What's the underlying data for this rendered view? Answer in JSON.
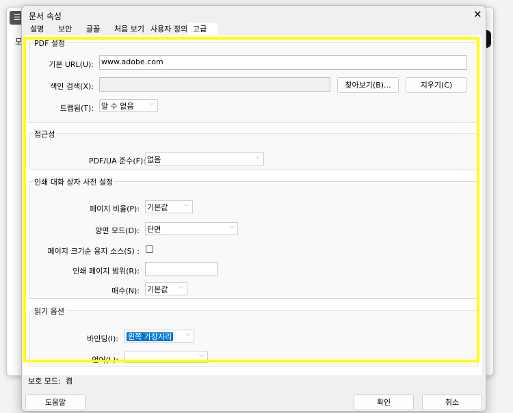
{
  "background": {
    "menu_icon": "hamburger-icon",
    "tab_text": "모"
  },
  "dialog": {
    "title": "문서 속성",
    "close_icon": "close-icon",
    "tabs": [
      "설명",
      "보안",
      "글꼴",
      "처음 보기",
      "사용자 정의",
      "고급"
    ],
    "pdf": {
      "title": "PDF 설정",
      "base_url_label": "기본 URL(U):",
      "base_url_value": "www.adobe.com",
      "index_label": "색인 검색(X):",
      "index_value": "",
      "browse_button": "찾아보기(B)...",
      "clear_button": "지우기(C)",
      "trapped_label": "트랩됨(T):",
      "trapped_value": "알 수 없음"
    },
    "accessibility": {
      "title": "접근성",
      "pdfua_label": "PDF/UA 준수(F):",
      "pdfua_value": "없음"
    },
    "print": {
      "title": "인쇄 대화 상자 사전 설정",
      "scaling_label": "페이지 비율(P):",
      "scaling_value": "기본값",
      "duplex_label": "양면 모드(D):",
      "duplex_value": "단면",
      "paper_source_label": "페이지 크기순 용지 소스(S) :",
      "paper_source_checked": false,
      "range_label": "인쇄 페이지 범위(R):",
      "range_value": "",
      "copies_label": "매수(N):",
      "copies_value": "기본값"
    },
    "reading": {
      "title": "읽기 옵션",
      "binding_label": "바인딩(I):",
      "binding_value": "왼쪽 가장자리",
      "language_label": "언어(L):",
      "language_value": ""
    },
    "status": {
      "label": "보호 모드:",
      "value": "켬"
    },
    "buttons": {
      "help": "도움말",
      "ok": "확인",
      "cancel": "취소"
    }
  }
}
